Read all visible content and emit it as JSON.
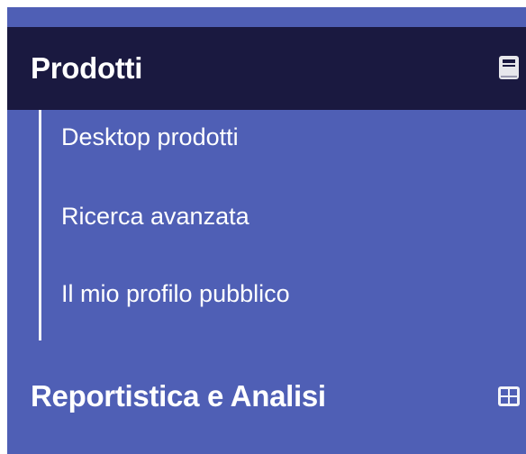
{
  "menu": {
    "sections": [
      {
        "label": "Prodotti",
        "icon": "book-icon",
        "active": true,
        "items": [
          {
            "label": "Desktop prodotti"
          },
          {
            "label": "Ricerca avanzata"
          },
          {
            "label": "Il mio profilo pubblico"
          }
        ]
      },
      {
        "label": "Reportistica e Analisi",
        "icon": "grid-icon",
        "active": false
      }
    ]
  },
  "colors": {
    "sidebar_bg": "#4f5fb5",
    "active_header_bg": "#1a1940",
    "text": "#ffffff",
    "tree_line": "#f2f3f8"
  }
}
